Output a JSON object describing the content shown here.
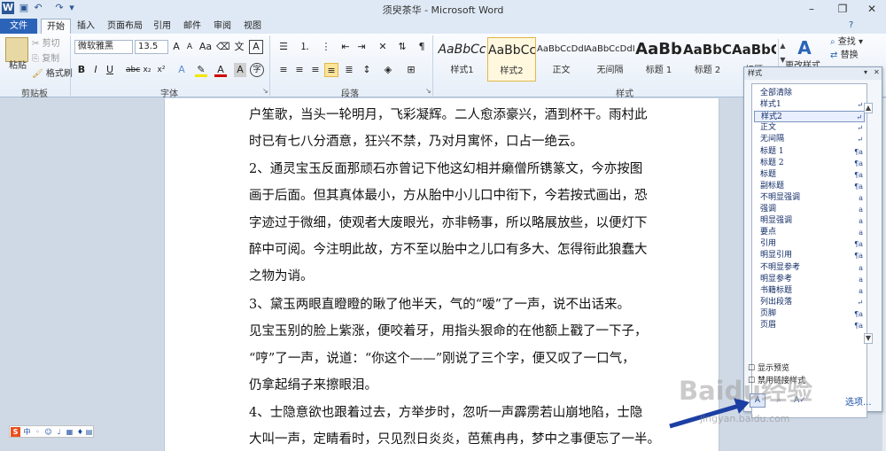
{
  "window": {
    "title": "须臾茶华 - Microsoft Word",
    "quick_access": [
      "word-icon",
      "save-icon",
      "undo-icon",
      "redo-icon"
    ],
    "controls": [
      "minimize-icon",
      "maximize-icon",
      "close-icon"
    ]
  },
  "tabs": [
    "文件",
    "开始",
    "插入",
    "页面布局",
    "引用",
    "邮件",
    "审阅",
    "视图"
  ],
  "ribbon": {
    "clipboard": {
      "label": "剪贴板",
      "paste": "粘贴",
      "cut": "剪切",
      "copy": "复制",
      "format_painter": "格式刷"
    },
    "font": {
      "label": "字体",
      "font_name": "微软雅黑",
      "font_size": "13.5"
    },
    "paragraph": {
      "label": "段落"
    },
    "styles": {
      "label": "样式",
      "items": [
        {
          "preview": "AaBbCc",
          "label": "样式1"
        },
        {
          "preview": "AaBbCc",
          "label": "样式2"
        },
        {
          "preview": "AaBbCcDdI",
          "label": "正文"
        },
        {
          "preview": "AaBbCcDdI",
          "label": "无间隔"
        },
        {
          "preview": "AaBb",
          "label": "标题 1"
        },
        {
          "preview": "AaBbC",
          "label": "标题 2"
        },
        {
          "preview": "AaBbC",
          "label": "标题"
        }
      ],
      "change_styles": "更改样式"
    },
    "editing": {
      "find": "查找",
      "replace": "替换"
    }
  },
  "document": {
    "lines": [
      "户笙歌，当头一轮明月，飞彩凝辉。二人愈添豪兴，酒到杯干。雨村此",
      "时已有七八分酒意，狂兴不禁，乃对月寓怀，口占一绝云。",
      "2、通灵宝玉反面那顽石亦曾记下他这幻相并癞僧所镌篆文，今亦按图",
      "画于后面。但其真体最小，方从胎中小儿口中衔下，今若按式画出，恐",
      "字迹过于微细，使观者大废眼光，亦非畅事，所以略展放些，以便灯下",
      "醉中可阅。今注明此故，方不至以胎中之儿口有多大、怎得衔此狼蠢大",
      "之物为诮。",
      "3、黛玉两眼直瞪瞪的瞅了他半天，气的“嗳”了一声，说不出话来。",
      "见宝玉别的脸上紫涨，便咬着牙，用指头狠命的在他额上戳了一下子，",
      " “哼”了一声，说道：“你这个——”刚说了三个字，便又叹了一口气，",
      "仍拿起绢子来擦眼泪。",
      "4、士隐意欲也跟着过去，方举步时，忽听一声霹雳若山崩地陷，士隐",
      "大叫一声，定睛看时，只见烈日炎炎，芭蕉冉冉，梦中之事便忘了一半。"
    ]
  },
  "styles_pane": {
    "title": "样式",
    "items": [
      {
        "name": "全部清除",
        "mark": ""
      },
      {
        "name": "样式1",
        "mark": "↵"
      },
      {
        "name": "样式2",
        "mark": "↵"
      },
      {
        "name": "正文",
        "mark": "↵"
      },
      {
        "name": "无间隔",
        "mark": "↵"
      },
      {
        "name": "标题 1",
        "mark": "¶a"
      },
      {
        "name": "标题 2",
        "mark": "¶a"
      },
      {
        "name": "标题",
        "mark": "¶a"
      },
      {
        "name": "副标题",
        "mark": "¶a"
      },
      {
        "name": "不明显强调",
        "mark": "a"
      },
      {
        "name": "强调",
        "mark": "a"
      },
      {
        "name": "明显强调",
        "mark": "a"
      },
      {
        "name": "要点",
        "mark": "a"
      },
      {
        "name": "引用",
        "mark": "¶a"
      },
      {
        "name": "明显引用",
        "mark": "¶a"
      },
      {
        "name": "不明显参考",
        "mark": "a"
      },
      {
        "name": "明显参考",
        "mark": "a"
      },
      {
        "name": "书籍标题",
        "mark": "a"
      },
      {
        "name": "列出段落",
        "mark": "↵"
      },
      {
        "name": "页脚",
        "mark": "¶a"
      },
      {
        "name": "页眉",
        "mark": "¶a"
      }
    ],
    "selected_index": 2,
    "show_preview": "显示预览",
    "disable_linked": "禁用链接样式",
    "options": "选项..."
  },
  "watermark": "Baidu经验",
  "watermark_url": "jingyan.baidu.com"
}
